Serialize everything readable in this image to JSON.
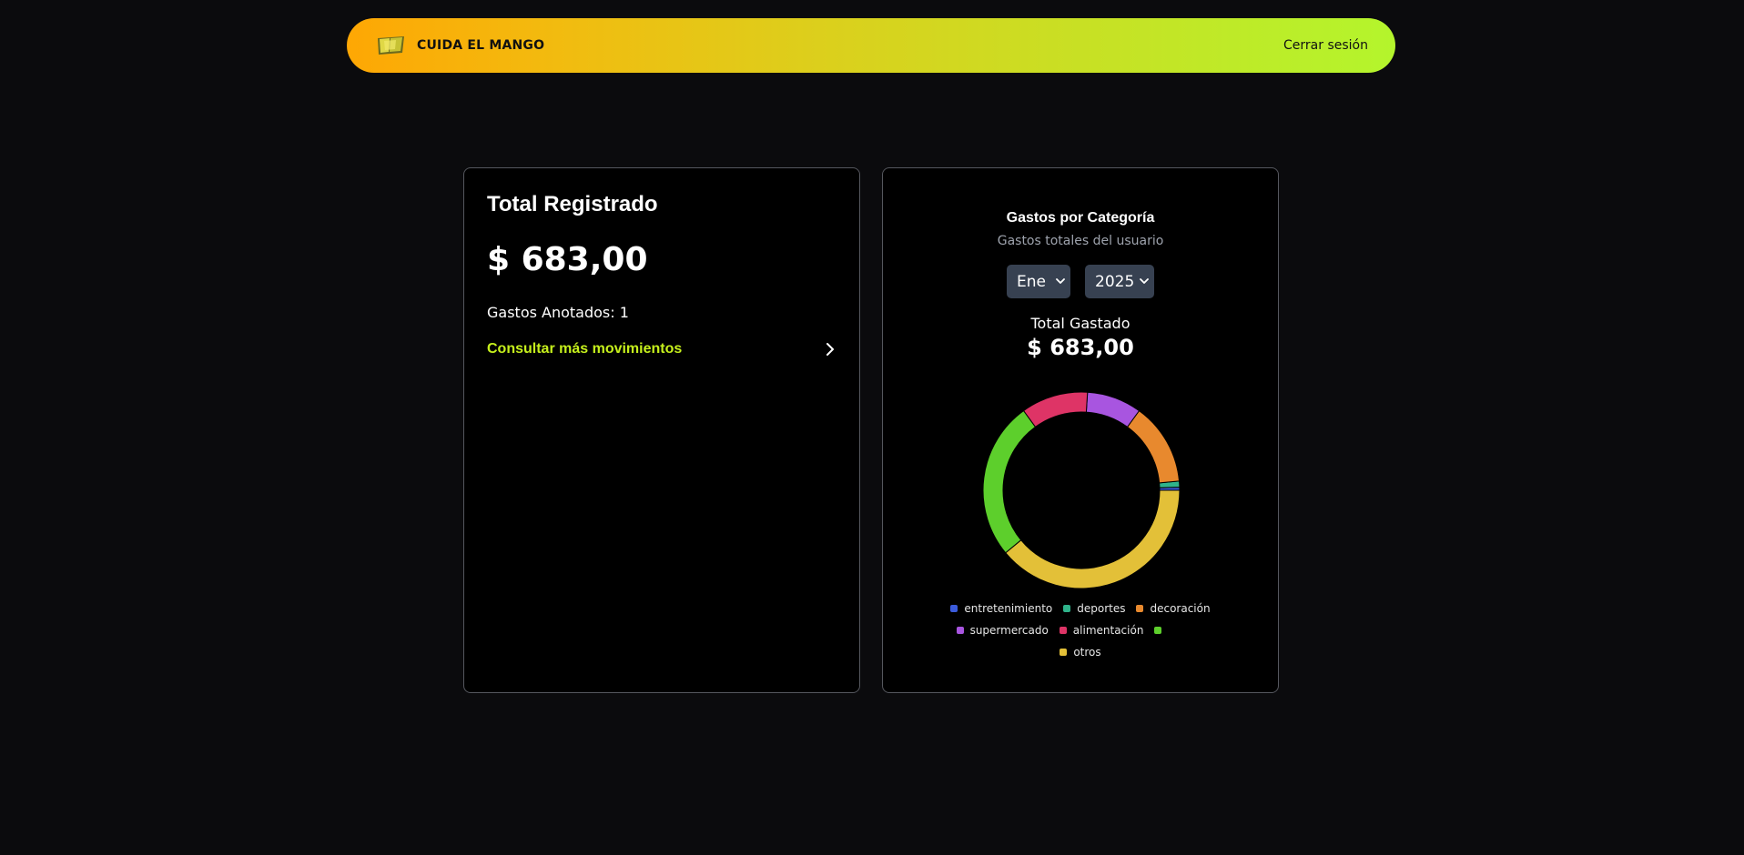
{
  "navbar": {
    "brand": "CUIDA EL MANGO",
    "logout": "Cerrar sesión",
    "logo_icon": "mango-flag-logo-icon"
  },
  "summary": {
    "title": "Total Registrado",
    "total": "$ 683,00",
    "count_label": "Gastos Anotados: 1",
    "more_link": "Consultar más movimientos",
    "more_icon": "chevron-right-icon"
  },
  "chart_card": {
    "title": "Gastos por Categoría",
    "subtitle": "Gastos totales del usuario",
    "month": "Ene",
    "year": "2025",
    "spent_label": "Total Gastado",
    "spent_amount": "$ 683,00",
    "caret_icon": "chevron-down-icon"
  },
  "chart_data": {
    "type": "pie",
    "variant": "doughnut",
    "legend_position": "bottom",
    "series": [
      {
        "name": "entretenimiento",
        "value": 0.5,
        "color": "#3b5bdb"
      },
      {
        "name": "deportes",
        "value": 1.0,
        "color": "#2fb38a"
      },
      {
        "name": "decoración",
        "value": 13.5,
        "color": "#e8892e"
      },
      {
        "name": "supermercado",
        "value": 9.0,
        "color": "#a855e0"
      },
      {
        "name": "alimentación",
        "value": 11.0,
        "color": "#de3466"
      },
      {
        "name": "",
        "value": 26.0,
        "color": "#5dcf2c"
      },
      {
        "name": "otros",
        "value": 39.0,
        "color": "#e3c038"
      }
    ]
  }
}
